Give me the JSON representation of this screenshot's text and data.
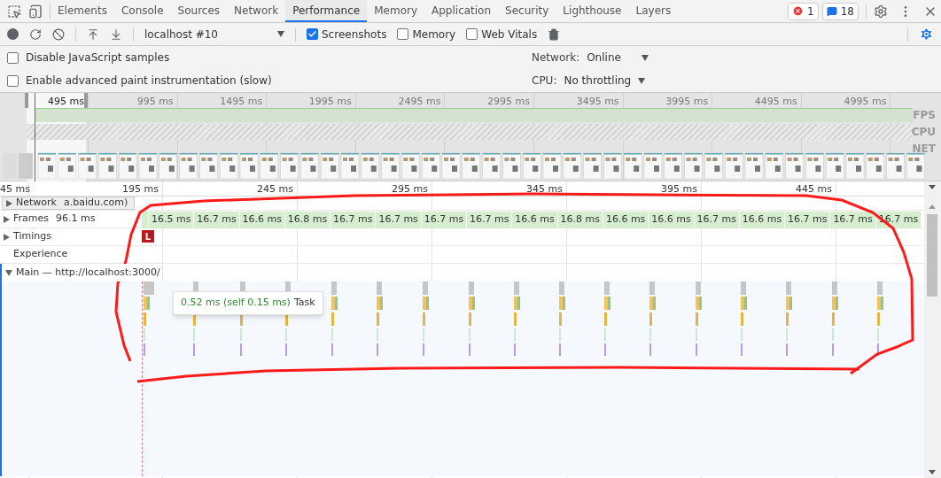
{
  "tabs": [
    {
      "label": "Elements",
      "selected": false
    },
    {
      "label": "Console",
      "selected": false
    },
    {
      "label": "Sources",
      "selected": false
    },
    {
      "label": "Network",
      "selected": false
    },
    {
      "label": "Performance",
      "selected": true
    },
    {
      "label": "Memory",
      "selected": false
    },
    {
      "label": "Application",
      "selected": false
    },
    {
      "label": "Security",
      "selected": false
    },
    {
      "label": "Lighthouse",
      "selected": false
    },
    {
      "label": "Layers",
      "selected": false
    }
  ],
  "badges": {
    "errors": "1",
    "messages": "18"
  },
  "toolbar": {
    "profile": "localhost #10",
    "checkboxes": [
      {
        "label": "Screenshots",
        "checked": true
      },
      {
        "label": "Memory",
        "checked": false
      },
      {
        "label": "Web Vitals",
        "checked": false
      }
    ]
  },
  "settings": {
    "options": [
      {
        "label": "Disable JavaScript samples",
        "checked": false
      },
      {
        "label": "Enable advanced paint instrumentation (slow)",
        "checked": false
      }
    ],
    "network": {
      "label": "Network:",
      "value": "Online"
    },
    "cpu": {
      "label": "CPU:",
      "value": "No throttling"
    }
  },
  "overview": {
    "ticks": [
      "495 ms",
      "995 ms",
      "1495 ms",
      "1995 ms",
      "2495 ms",
      "2995 ms",
      "3495 ms",
      "3995 ms",
      "4495 ms",
      "4995 ms"
    ],
    "lanes": [
      "FPS",
      "CPU",
      "NET"
    ]
  },
  "ruler": {
    "ticks": [
      "45 ms",
      "195 ms",
      "245 ms",
      "295 ms",
      "345 ms",
      "395 ms",
      "445 ms"
    ]
  },
  "tracks": [
    {
      "label": "Network",
      "extra": "a.baidu.com)",
      "expanded": false
    },
    {
      "label": "Frames",
      "extra": "96.1 ms",
      "expanded": false
    },
    {
      "label": "Timings",
      "expanded": false
    },
    {
      "label": "Experience"
    },
    {
      "label": "Main — http://localhost:3000/",
      "expanded": true
    }
  ],
  "frames": [
    "16.5 ms",
    "16.7 ms",
    "16.6 ms",
    "16.8 ms",
    "16.7 ms",
    "16.7 ms",
    "16.7 ms",
    "16.7 ms",
    "16.6 ms",
    "16.8 ms",
    "16.6 ms",
    "16.6 ms",
    "16.7 ms",
    "16.6 ms",
    "16.7 ms",
    "16.7 ms",
    "16.7 ms"
  ],
  "timing_marker": "L",
  "tooltip": {
    "time": "0.52 ms (self 0.15 ms)",
    "name": "Task"
  }
}
